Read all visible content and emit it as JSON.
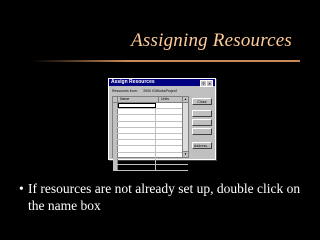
{
  "slide": {
    "title": "Assigning Resources",
    "bullet": "If resources are not already set up, double click on the name box"
  },
  "dialog": {
    "title": "Assign Resources",
    "resources_from_label": "Resources from:",
    "resources_from_value": "'2000 IGWorksProject'",
    "columns": [
      "Name",
      "Units"
    ],
    "row_count": 11,
    "buttons": {
      "close": "Close",
      "assign": "",
      "remove": "",
      "replace": "",
      "address": "Address..."
    }
  },
  "colors": {
    "background": "#000000",
    "title": "#ffcc99",
    "dialog_titlebar": "#000080"
  }
}
